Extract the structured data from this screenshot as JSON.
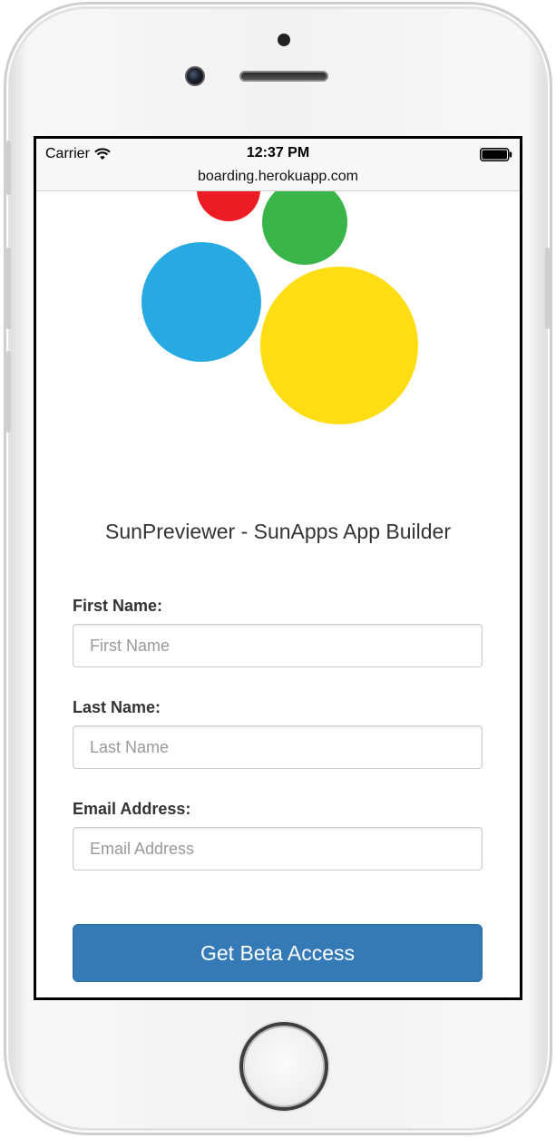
{
  "status_bar": {
    "carrier": "Carrier",
    "time": "12:37 PM",
    "url": "boarding.herokuapp.com",
    "icons": [
      "wifi-icon",
      "battery-icon"
    ]
  },
  "logo": {
    "circle_colors": [
      "#ed1c24",
      "#3ab54a",
      "#27aae1",
      "#ffdd15"
    ]
  },
  "page": {
    "title": "SunPreviewer - SunApps App Builder"
  },
  "form": {
    "first_name": {
      "label": "First Name:",
      "placeholder": "First Name",
      "value": ""
    },
    "last_name": {
      "label": "Last Name:",
      "placeholder": "Last Name",
      "value": ""
    },
    "email": {
      "label": "Email Address:",
      "placeholder": "Email Address",
      "value": ""
    },
    "submit_label": "Get Beta Access"
  },
  "colors": {
    "button_primary": "#337ab7",
    "text": "#333333"
  }
}
